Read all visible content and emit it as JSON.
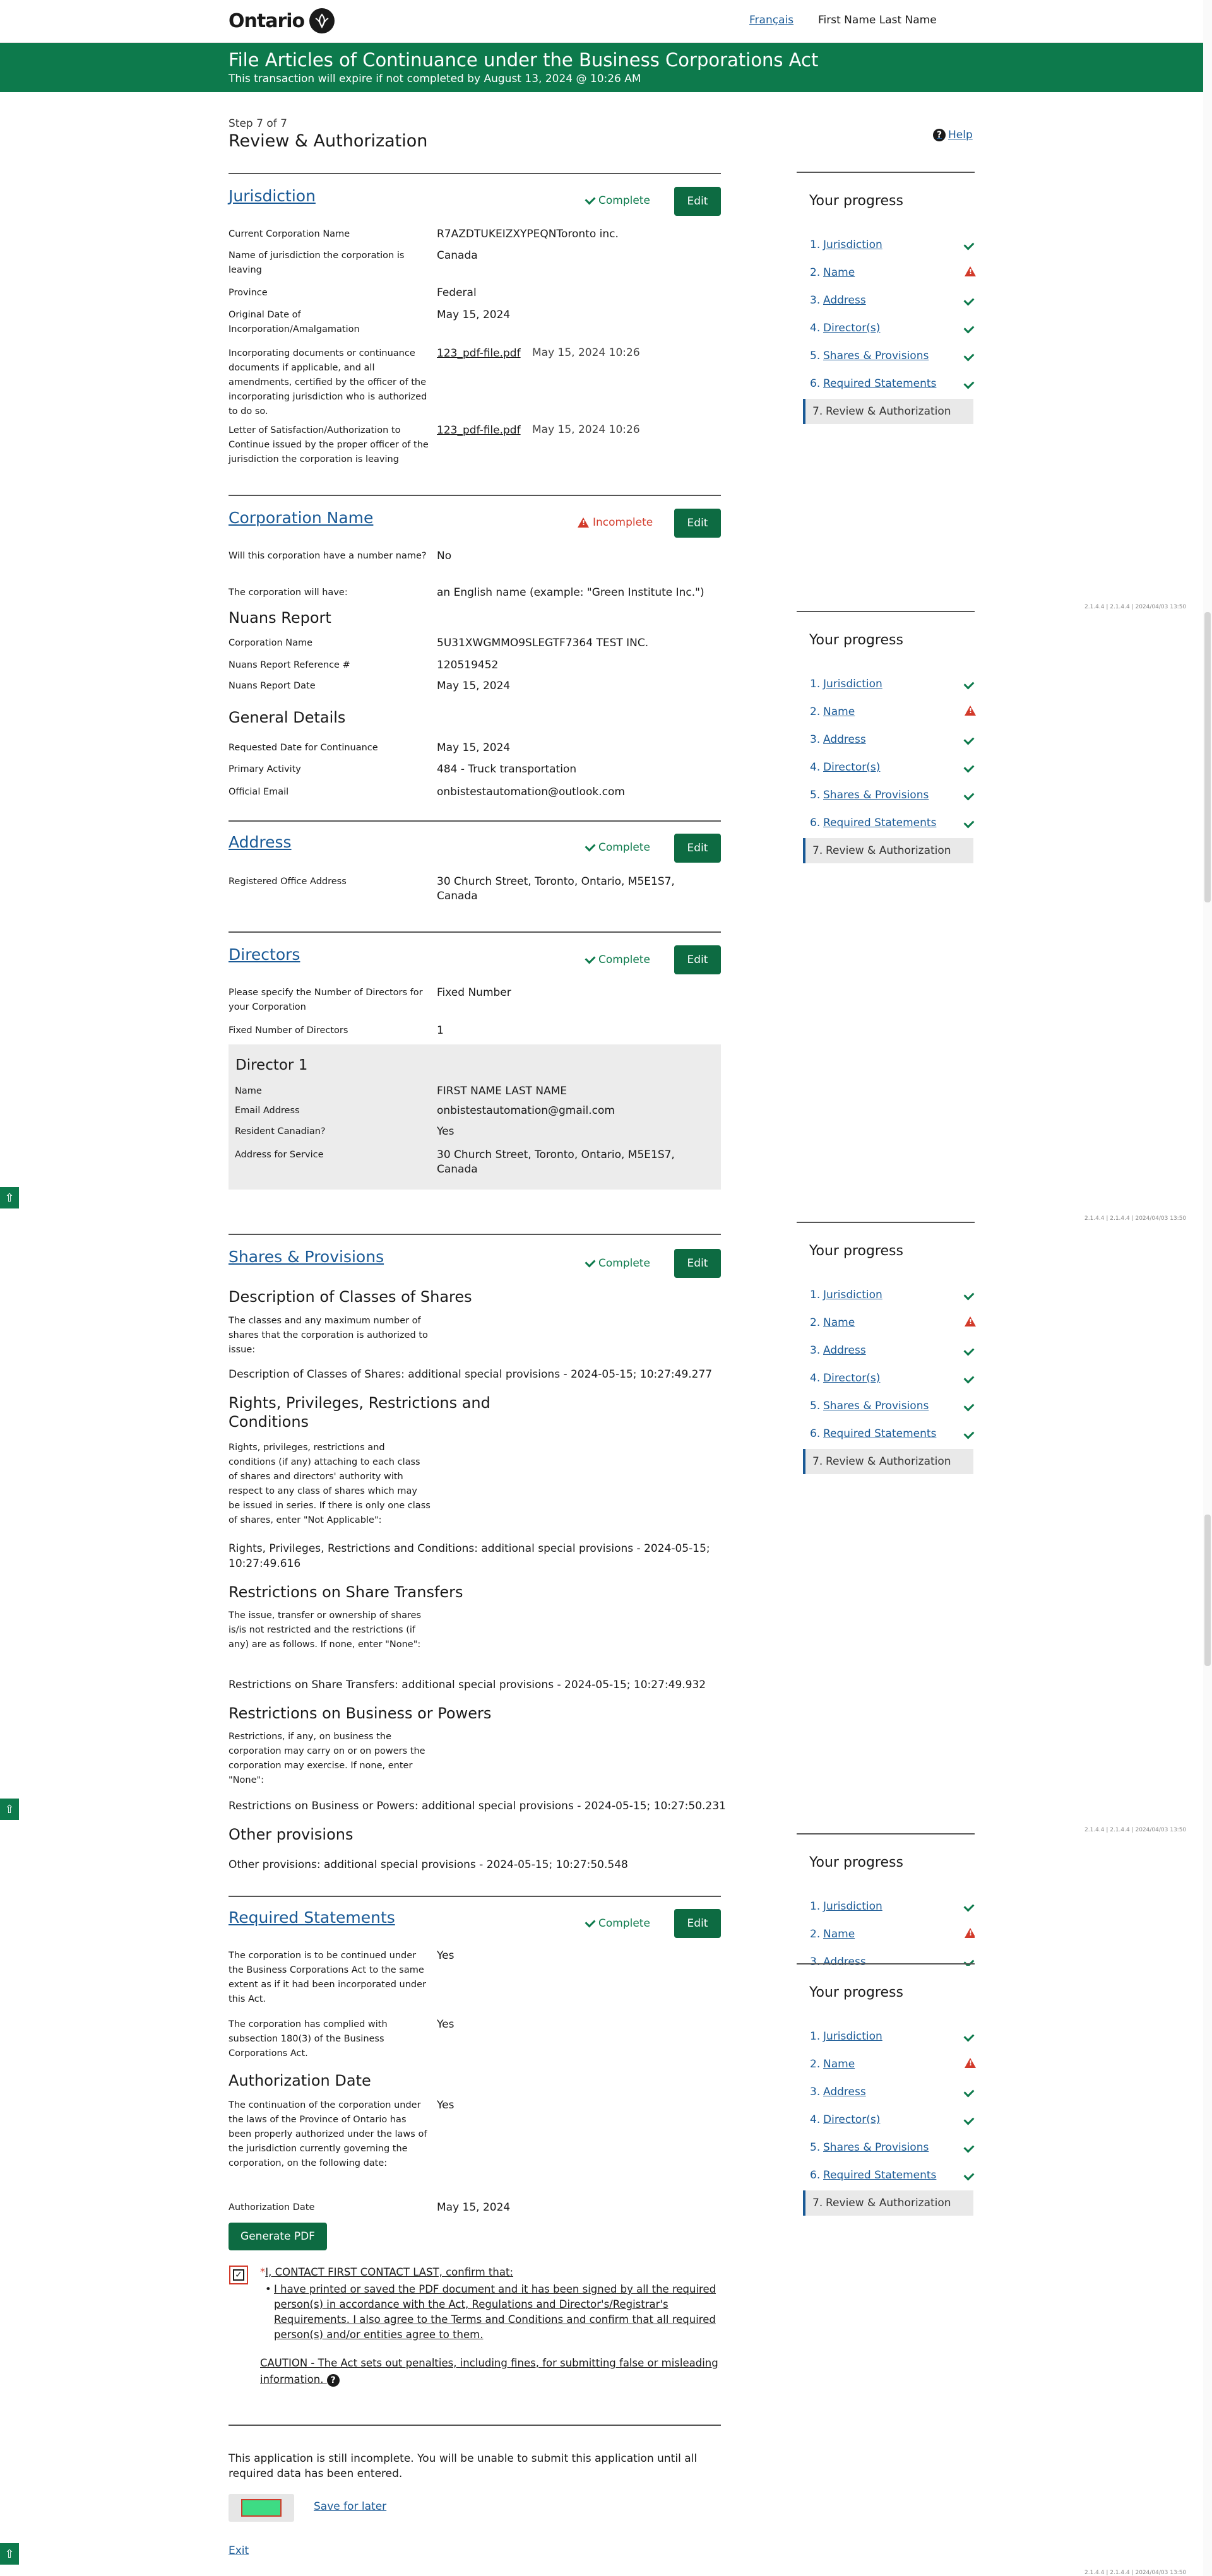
{
  "header": {
    "logo_text": "Ontario",
    "logo_icon": "trillium-icon",
    "lang_link": "Français",
    "user_name": "First Name Last Name"
  },
  "banner": {
    "title": "File Articles of Continuance under the Business Corporations Act",
    "subtitle": "This transaction will expire if not completed by August 13, 2024 @ 10:26 AM"
  },
  "page": {
    "step": "Step 7 of 7",
    "title": "Review & Authorization",
    "help": "Help"
  },
  "status_labels": {
    "complete": "Complete",
    "incomplete": "Incomplete",
    "edit": "Edit"
  },
  "colors": {
    "brand_green": "#0d7a4c",
    "button_green": "#0d6b42",
    "error_red": "#d23a2a",
    "link_blue": "#1a5a96"
  },
  "jurisdiction": {
    "title": "Jurisdiction",
    "rows": [
      {
        "label": "Current Corporation Name",
        "value": "R7AZDTUKEIZXYPEQNToronto inc."
      },
      {
        "label": "Name of jurisdiction the corporation is leaving",
        "value": "Canada"
      },
      {
        "label": "Province",
        "value": "Federal"
      },
      {
        "label": "Original Date of Incorporation/Amalgamation",
        "value": "May 15, 2024"
      },
      {
        "label": "Incorporating documents or continuance documents if applicable, and all amendments, certified by the officer of the incorporating jurisdiction who is authorized to do so.",
        "file": "123_pdf-file.pdf",
        "date": "May 15, 2024 10:26"
      },
      {
        "label": "Letter of Satisfaction/Authorization to Continue issued by the proper officer of the jurisdiction the corporation is leaving",
        "file": "123_pdf-file.pdf",
        "date": "May 15, 2024 10:26"
      }
    ]
  },
  "corp_name": {
    "title": "Corporation Name",
    "rows": [
      {
        "label": "Will this corporation have a number name?",
        "value": "No"
      },
      {
        "label": "The corporation will have:",
        "value": "an English name (example: \"Green Institute Inc.\")"
      }
    ],
    "nuans_heading": "Nuans Report",
    "nuans_rows": [
      {
        "label": "Corporation Name",
        "value": "5U31XWGMMO9SLEGTF7364 TEST INC."
      },
      {
        "label": "Nuans Report Reference #",
        "value": "120519452"
      },
      {
        "label": "Nuans Report Date",
        "value": "May 15, 2024"
      }
    ],
    "general_heading": "General Details",
    "general_rows": [
      {
        "label": "Requested Date for Continuance",
        "value": "May 15, 2024"
      },
      {
        "label": "Primary Activity",
        "value": "484 - Truck transportation"
      },
      {
        "label": "Official Email",
        "value": "onbistestautomation@outlook.com"
      }
    ]
  },
  "address": {
    "title": "Address",
    "rows": [
      {
        "label": "Registered Office Address",
        "value": "30 Church Street, Toronto, Ontario, M5E1S7, Canada"
      }
    ]
  },
  "directors": {
    "title": "Directors",
    "rows": [
      {
        "label": "Please specify the Number of Directors for your Corporation",
        "value": "Fixed Number"
      },
      {
        "label": "Fixed Number of Directors",
        "value": "1"
      }
    ],
    "director_title": "Director 1",
    "director_rows": [
      {
        "label": "Name",
        "value": "FIRST NAME LAST NAME"
      },
      {
        "label": "Email Address",
        "value": "onbistestautomation@gmail.com"
      },
      {
        "label": "Resident Canadian?",
        "value": "Yes"
      },
      {
        "label": "Address for Service",
        "value": "30 Church Street, Toronto, Ontario, M5E1S7, Canada"
      }
    ]
  },
  "shares": {
    "title": "Shares & Provisions",
    "classes_heading": "Description of Classes of Shares",
    "classes_label": "The classes and any maximum number of shares that the corporation is authorized to issue:",
    "classes_value": "Description of Classes of Shares: additional special provisions - 2024-05-15; 10:27:49.277",
    "rights_heading": "Rights, Privileges, Restrictions and Conditions",
    "rights_label": "Rights, privileges, restrictions and conditions (if any) attaching to each class of shares and directors' authority with respect to any class of shares which may be issued in series. If there is only one class of shares, enter \"Not Applicable\":",
    "rights_value": "Rights, Privileges, Restrictions and Conditions: additional special provisions - 2024-05-15; 10:27:49.616",
    "transfer_heading": "Restrictions on Share Transfers",
    "transfer_label": "The issue, transfer or ownership of shares is/is not restricted and the restrictions (if any) are as follows. If none, enter \"None\":",
    "transfer_value": "Restrictions on Share Transfers: additional special provisions - 2024-05-15; 10:27:49.932",
    "business_heading": "Restrictions on Business or Powers",
    "business_label": "Restrictions, if any, on business the corporation may carry on or on powers the corporation may exercise. If none, enter \"None\":",
    "business_value": "Restrictions on Business or Powers: additional special provisions - 2024-05-15; 10:27:50.231",
    "other_heading": "Other provisions",
    "other_value": "Other provisions: additional special provisions - 2024-05-15; 10:27:50.548"
  },
  "required": {
    "title": "Required Statements",
    "rows": [
      {
        "label": "The corporation is to be continued under the Business Corporations Act to the same extent as if it had been incorporated under this Act.",
        "value": "Yes"
      },
      {
        "label": "The corporation has complied with subsection 180(3) of the Business Corporations Act.",
        "value": "Yes"
      }
    ],
    "auth_heading": "Authorization Date",
    "auth_rows": [
      {
        "label": "The continuation of the corporation under the laws of the Province of Ontario has been properly authorized under the laws of the jurisdiction currently governing the corporation, on the following date:",
        "value": "Yes"
      },
      {
        "label": "Authorization Date",
        "value": "May 15, 2024"
      }
    ]
  },
  "footer": {
    "generate_pdf": "Generate PDF",
    "confirm_required": "*",
    "confirm_label": "I, CONTACT FIRST CONTACT LAST, confirm that:",
    "confirm_item": "I have printed or saved the PDF document and it has been signed by all the required person(s) in accordance with the Act, Regulations and Director's/Registrar's Requirements. I also agree to the Terms and Conditions and confirm that all required person(s) and/or entities agree to them.",
    "caution": "CAUTION - The Act sets out penalties, including fines, for submitting false or misleading information.",
    "incomplete_msg": "This application is still incomplete. You will be unable to submit this application until all required data has been entered.",
    "save_later": "Save for later",
    "exit": "Exit"
  },
  "progress": {
    "title": "Your progress",
    "items": [
      {
        "num": "1.",
        "label": "Jurisdiction",
        "status": "complete"
      },
      {
        "num": "2.",
        "label": "Name",
        "status": "incomplete"
      },
      {
        "num": "3.",
        "label": "Address",
        "status": "complete"
      },
      {
        "num": "4.",
        "label": "Director(s)",
        "status": "complete"
      },
      {
        "num": "5.",
        "label": "Shares & Provisions",
        "status": "complete"
      },
      {
        "num": "6.",
        "label": "Required Statements",
        "status": "complete"
      },
      {
        "num": "7.",
        "label": "Review & Authorization",
        "status": "current"
      }
    ]
  },
  "version": "2.1.4.4 | 2.1.4.4 | 2024/04/03 13:50"
}
